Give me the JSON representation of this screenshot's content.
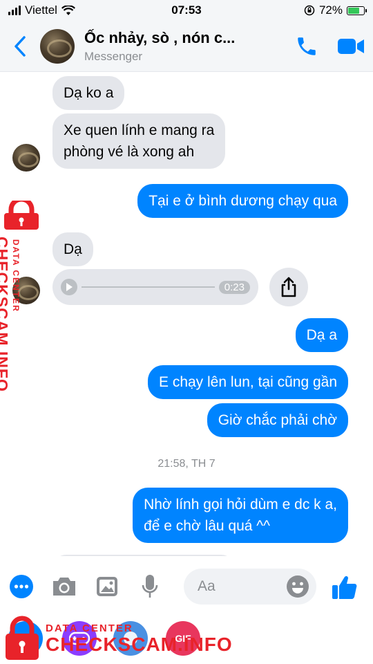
{
  "status_bar": {
    "carrier": "Viettel",
    "time": "07:53",
    "battery": "72%",
    "battery_level": 0.72
  },
  "header": {
    "title": "Ốc nhảy, sò , nón c...",
    "subtitle": "Messenger"
  },
  "messages": [
    {
      "direction": "in",
      "text": "Dạ ko a"
    },
    {
      "direction": "in",
      "lines": [
        "Xe quen lính e mang ra",
        "phòng vé là xong ah"
      ]
    },
    {
      "direction": "out",
      "text": "Tại e ở bình dương chạy qua"
    },
    {
      "direction": "in",
      "text": "Dạ"
    },
    {
      "direction": "in",
      "type": "audio",
      "duration": "0:23"
    },
    {
      "direction": "out",
      "text": "Dạ a"
    },
    {
      "direction": "out",
      "text": "E chạy lên lun, tại cũng gần"
    },
    {
      "direction": "out",
      "text": "Giờ chắc phải chờ"
    },
    {
      "direction": "out",
      "lines": [
        "Nhờ lính gọi hỏi dùm e dc k a,",
        "để e chờ lâu quá ^^"
      ]
    }
  ],
  "timestamp": "21:58, TH 7",
  "composer": {
    "placeholder": "Aa"
  },
  "tray": {
    "gif_label": "GIF"
  },
  "watermark": {
    "small": "DATA CENTER",
    "big": "CHECKSCAM.INFO"
  },
  "colors": {
    "accent": "#0084ff",
    "incoming": "#e4e6eb",
    "watermark": "#e8232a"
  },
  "icons": [
    "back-chevron",
    "phone",
    "video-camera",
    "play",
    "share",
    "more-dots",
    "camera",
    "photo",
    "microphone",
    "emoji",
    "thumbs-up",
    "gamepad",
    "sticker",
    "gif",
    "lock"
  ]
}
